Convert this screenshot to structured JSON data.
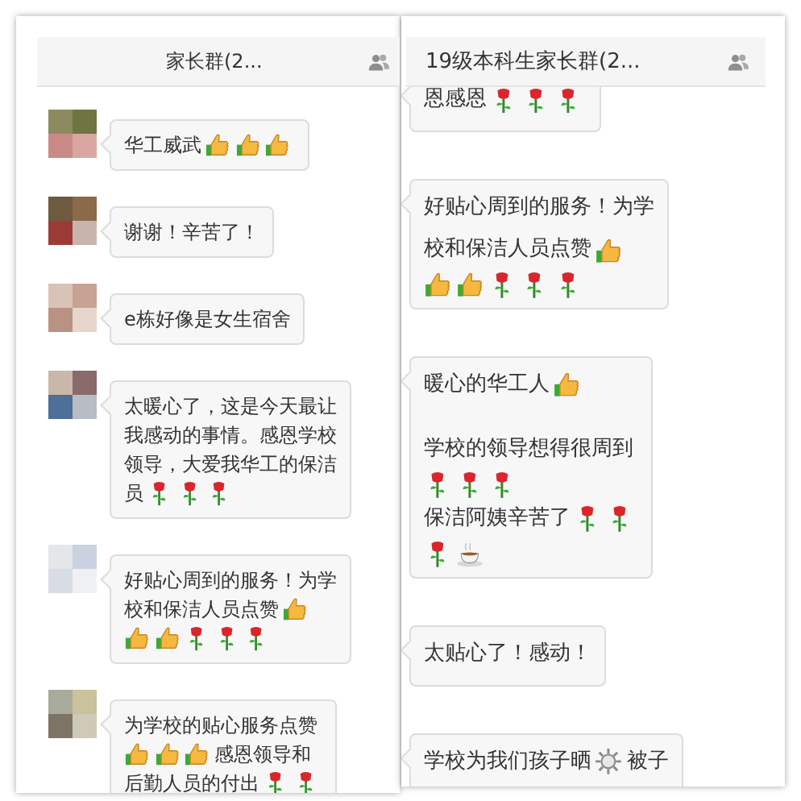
{
  "panels": [
    {
      "title": "家长群(2...",
      "messages": [
        {
          "avatar": true,
          "paragraphs": [
            [
              [
                {
                  "kind": "text",
                  "text": "华工威武"
                },
                {
                  "kind": "thumbs-up"
                },
                {
                  "kind": "thumbs-up"
                },
                {
                  "kind": "thumbs-up"
                }
              ]
            ]
          ]
        },
        {
          "avatar": true,
          "paragraphs": [
            [
              [
                {
                  "kind": "text",
                  "text": "谢谢！辛苦了！"
                }
              ]
            ]
          ]
        },
        {
          "avatar": true,
          "paragraphs": [
            [
              [
                {
                  "kind": "text",
                  "text": "e栋好像是女生宿舍"
                }
              ]
            ]
          ]
        },
        {
          "avatar": true,
          "paragraphs": [
            [
              [
                {
                  "kind": "text",
                  "text": "太暖心了，这是今天最让"
                }
              ],
              [
                {
                  "kind": "text",
                  "text": "我感动的事情。感恩学校"
                }
              ],
              [
                {
                  "kind": "text",
                  "text": "领导，大爱我华工的保洁"
                }
              ],
              [
                {
                  "kind": "text",
                  "text": "员"
                },
                {
                  "kind": "rose"
                },
                {
                  "kind": "rose"
                },
                {
                  "kind": "rose"
                }
              ]
            ]
          ]
        },
        {
          "avatar": true,
          "paragraphs": [
            [
              [
                {
                  "kind": "text",
                  "text": "好贴心周到的服务！为学"
                }
              ],
              [
                {
                  "kind": "text",
                  "text": "校和保洁人员点赞"
                },
                {
                  "kind": "thumbs-up"
                }
              ],
              [
                {
                  "kind": "thumbs-up"
                },
                {
                  "kind": "thumbs-up"
                },
                {
                  "kind": "rose"
                },
                {
                  "kind": "rose"
                },
                {
                  "kind": "rose"
                }
              ]
            ]
          ]
        },
        {
          "avatar": true,
          "paragraphs": [
            [
              [
                {
                  "kind": "text",
                  "text": "为学校的贴心服务点赞"
                }
              ],
              [
                {
                  "kind": "thumbs-up"
                },
                {
                  "kind": "thumbs-up"
                },
                {
                  "kind": "thumbs-up"
                },
                {
                  "kind": "text",
                  "text": "感恩领导和"
                }
              ],
              [
                {
                  "kind": "text",
                  "text": "后勤人员的付出"
                },
                {
                  "kind": "rose"
                },
                {
                  "kind": "rose"
                }
              ]
            ]
          ]
        }
      ]
    },
    {
      "title": "19级本科生家长群(2...",
      "messages": [
        {
          "avatar": false,
          "paragraphs": [
            [
              [
                {
                  "kind": "text",
                  "text": "恩感恩"
                },
                {
                  "kind": "rose"
                },
                {
                  "kind": "rose"
                },
                {
                  "kind": "rose"
                }
              ]
            ]
          ]
        },
        {
          "avatar": false,
          "paragraphs": [
            [
              [
                {
                  "kind": "text",
                  "text": "好贴心周到的服务！为学"
                }
              ],
              [
                {
                  "kind": "text",
                  "text": "校和保洁人员点赞"
                },
                {
                  "kind": "thumbs-up"
                }
              ],
              [
                {
                  "kind": "thumbs-up"
                },
                {
                  "kind": "thumbs-up"
                },
                {
                  "kind": "rose"
                },
                {
                  "kind": "rose"
                },
                {
                  "kind": "rose"
                }
              ]
            ]
          ]
        },
        {
          "avatar": false,
          "paragraphs": [
            [
              [
                {
                  "kind": "text",
                  "text": "暖心的华工人"
                },
                {
                  "kind": "thumbs-up"
                }
              ]
            ],
            [
              [
                {
                  "kind": "text",
                  "text": "学校的领导想得很周到"
                }
              ],
              [
                {
                  "kind": "rose"
                },
                {
                  "kind": "rose"
                },
                {
                  "kind": "rose"
                }
              ],
              [
                {
                  "kind": "text",
                  "text": "保洁阿姨辛苦了"
                },
                {
                  "kind": "rose"
                },
                {
                  "kind": "rose"
                }
              ],
              [
                {
                  "kind": "rose"
                },
                {
                  "kind": "coffee"
                }
              ]
            ]
          ]
        },
        {
          "avatar": false,
          "paragraphs": [
            [
              [
                {
                  "kind": "text",
                  "text": "太贴心了！感动！"
                }
              ]
            ]
          ]
        },
        {
          "avatar": false,
          "paragraphs": [
            [
              [
                {
                  "kind": "text",
                  "text": "学校为我们孩子晒"
                },
                {
                  "kind": "sun"
                },
                {
                  "kind": "text",
                  "text": "被子"
                }
              ]
            ]
          ]
        }
      ]
    }
  ]
}
